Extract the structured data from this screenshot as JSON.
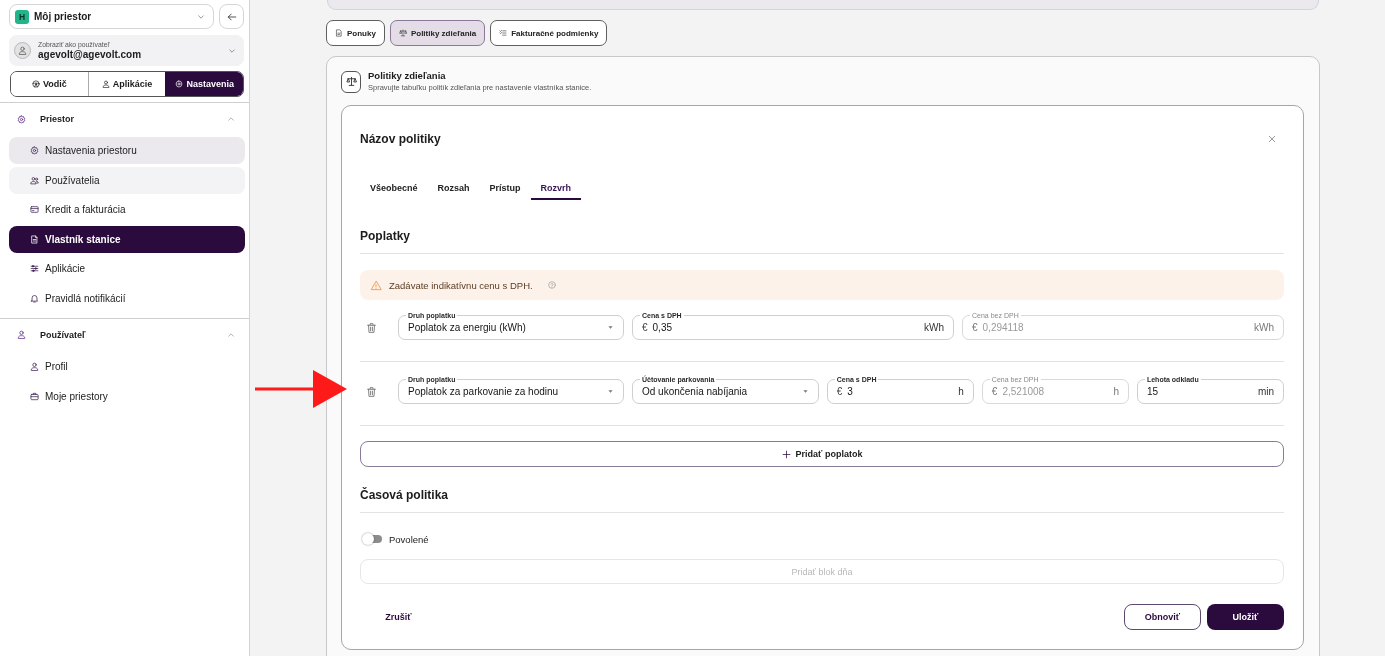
{
  "sidebar": {
    "workspace": {
      "badge": "H",
      "name": "Môj priestor"
    },
    "user": {
      "caption": "Zobraziť ako používateľ",
      "email": "agevolt@agevolt.com"
    },
    "modes": [
      {
        "label": "Vodič",
        "selected": false
      },
      {
        "label": "Aplikácie",
        "selected": false
      },
      {
        "label": "Nastavenia",
        "selected": true
      }
    ],
    "sections": [
      {
        "label": "Priestor",
        "expanded": true,
        "items": [
          {
            "label": "Nastavenia priestoru",
            "selected": false,
            "highlighted": true,
            "hovered": false
          },
          {
            "label": "Používatelia",
            "selected": false,
            "highlighted": false,
            "hovered": true
          },
          {
            "label": "Kredit a fakturácia",
            "selected": false,
            "highlighted": false,
            "hovered": false
          },
          {
            "label": "Vlastník stanice",
            "selected": true,
            "highlighted": false,
            "hovered": false
          },
          {
            "label": "Aplikácie",
            "selected": false,
            "highlighted": false,
            "hovered": false
          },
          {
            "label": "Pravidlá notifikácií",
            "selected": false,
            "highlighted": false,
            "hovered": false
          }
        ]
      },
      {
        "label": "Používateľ",
        "expanded": true,
        "items": [
          {
            "label": "Profil",
            "selected": false,
            "highlighted": false,
            "hovered": false
          },
          {
            "label": "Moje priestory",
            "selected": false,
            "highlighted": false,
            "hovered": false
          }
        ]
      }
    ]
  },
  "top_tabs": [
    {
      "label": "Ponuky",
      "selected": false
    },
    {
      "label": "Politiky zdieľania",
      "selected": true
    },
    {
      "label": "Fakturačné podmienky",
      "selected": false
    }
  ],
  "card": {
    "title": "Politiky zdieľania",
    "subtitle": "Spravujte tabuľku politík zdieľania pre nastavenie vlastníka stanice."
  },
  "dialog": {
    "title": "Názov politiky",
    "tabs": [
      {
        "label": "Všeobecné",
        "selected": false
      },
      {
        "label": "Rozsah",
        "selected": false
      },
      {
        "label": "Prístup",
        "selected": false
      },
      {
        "label": "Rozvrh",
        "selected": true
      }
    ],
    "fees": {
      "heading": "Poplatky",
      "notice": "Zadávate indikatívnu cenu s DPH.",
      "rows": [
        {
          "fields": [
            {
              "kind": "select",
              "label": "Druh poplatku",
              "value": "Poplatok za energiu (kWh)",
              "disabled": false
            },
            {
              "kind": "input",
              "label": "Cena s DPH",
              "prefix": "€",
              "value": "0,35",
              "suffix": "kWh",
              "disabled": false
            },
            {
              "kind": "input",
              "label": "Cena bez DPH",
              "prefix": "€",
              "value": "0,294118",
              "suffix": "kWh",
              "disabled": true
            }
          ]
        },
        {
          "fields": [
            {
              "kind": "select",
              "label": "Druh poplatku",
              "value": "Poplatok za parkovanie za hodinu",
              "disabled": false
            },
            {
              "kind": "select",
              "label": "Účtovanie parkovania",
              "value": "Od ukončenia nabíjania",
              "disabled": false
            },
            {
              "kind": "input",
              "label": "Cena s DPH",
              "prefix": "€",
              "value": "3",
              "suffix": "h",
              "disabled": false
            },
            {
              "kind": "input",
              "label": "Cena bez DPH",
              "prefix": "€",
              "value": "2,521008",
              "suffix": "h",
              "disabled": true
            },
            {
              "kind": "input",
              "label": "Lehota odkladu",
              "value": "15",
              "suffix": "min",
              "disabled": false
            }
          ]
        }
      ],
      "add_button": "Pridať poplatok"
    },
    "time_policy": {
      "heading": "Časová politika",
      "toggle": {
        "label": "Povolené",
        "on": false
      },
      "add_block_button": {
        "label": "Pridať blok dňa",
        "disabled": true
      }
    },
    "buttons": [
      {
        "kind": "text",
        "label": "Zrušiť"
      },
      {
        "kind": "outline",
        "label": "Obnoviť"
      },
      {
        "kind": "primary",
        "label": "Uložiť"
      }
    ]
  },
  "annotations": [
    {
      "kind": "arrow"
    }
  ]
}
